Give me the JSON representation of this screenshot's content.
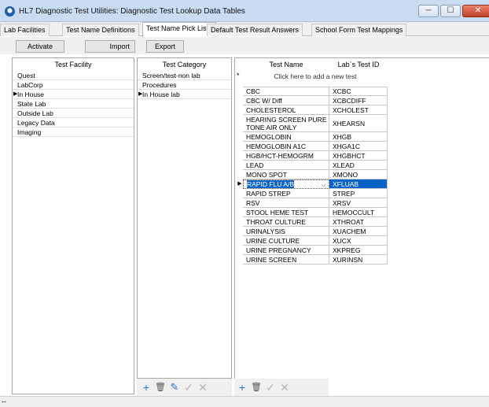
{
  "window": {
    "title": "HL7 Diagnostic Test Utilities:  Diagnostic Test Lookup Data Tables",
    "minimize": "─",
    "maximize": "☐",
    "close": "✕"
  },
  "tabs": [
    {
      "label": "Lab Facilities"
    },
    {
      "label": "Test Name Definitions"
    },
    {
      "label": "Test Name Pick Lists"
    },
    {
      "label": "Default Test Result Answers"
    },
    {
      "label": "School Form Test Mappings"
    }
  ],
  "active_tab": "Test Name Pick Lists",
  "toolbar": {
    "activate": "Activate",
    "import": "Import",
    "export": "Export"
  },
  "facility_panel": {
    "header": "Test Facility",
    "items": [
      "Quest",
      "LabCorp",
      "In House",
      "State Lab",
      "Outside Lab",
      "Legacy  Data",
      "Imaging"
    ],
    "selected": "In House"
  },
  "category_panel": {
    "header": "Test Category",
    "items": [
      "Screen/test-non lab",
      "Procedures",
      "In House lab"
    ],
    "selected": "In House lab"
  },
  "tests_panel": {
    "col_name": "Test Name",
    "col_id": "Lab`s Test ID",
    "new_row_marker": "*",
    "add_placeholder": "Click here to add a new test",
    "rows": [
      {
        "name": "CBC",
        "id": "XCBC"
      },
      {
        "name": "CBC W/ Diff",
        "id": "XCBCDIFF"
      },
      {
        "name": "CHOLESTEROL",
        "id": "XCHOLEST"
      },
      {
        "name": "HEARING SCREEN PURE TONE AIR ONLY",
        "id": "XHEARSN"
      },
      {
        "name": "HEMOGLOBIN",
        "id": "XHGB"
      },
      {
        "name": "HEMOGLOBIN A1C",
        "id": "XHGA1C"
      },
      {
        "name": "HGB/HCT-HEMOGRM",
        "id": "XHGBHCT"
      },
      {
        "name": "LEAD",
        "id": "XLEAD"
      },
      {
        "name": "MONO SPOT",
        "id": "XMONO"
      },
      {
        "name": "RAPID FLU A/B",
        "id": "XFLUAB"
      },
      {
        "name": "RAPID STREP",
        "id": "STREP"
      },
      {
        "name": "RSV",
        "id": "XRSV"
      },
      {
        "name": "STOOL HEME TEST",
        "id": "HEMOCCULT"
      },
      {
        "name": "THROAT CULTURE",
        "id": "XTHROAT"
      },
      {
        "name": "URINALYSIS",
        "id": "XUACHEM"
      },
      {
        "name": "URINE CULTURE",
        "id": "XUCX"
      },
      {
        "name": "URINE PREGNANCY",
        "id": "XKPREG"
      },
      {
        "name": "URINE SCREEN",
        "id": "XURINSN"
      }
    ],
    "selected_row": "RAPID FLU A/B"
  },
  "icons": {
    "row_marker": "▶",
    "dropdown": "⌵",
    "add": "+",
    "delete": "🗑",
    "edit": "✎",
    "confirm": "✓",
    "cancel": "✕"
  },
  "status_bar": {
    "text": "--"
  },
  "colors": {
    "selection": "#0a64c8",
    "titlebar": "#c9dcf2",
    "close_button": "#c2402b",
    "add_icon": "#2a6fc0",
    "disabled_icon": "#b5b5b5"
  }
}
